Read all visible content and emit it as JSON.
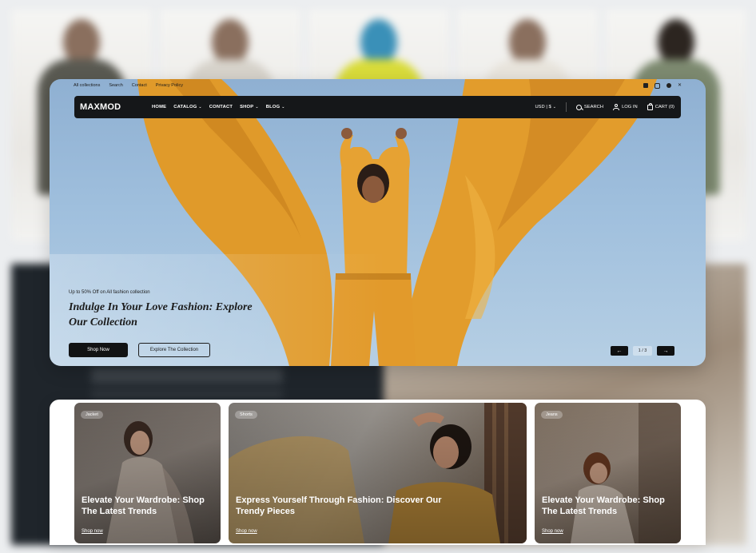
{
  "topbar": {
    "links": [
      "All collections",
      "Search",
      "Contact",
      "Privacy Policy"
    ],
    "socials": [
      "facebook-icon",
      "instagram-icon",
      "pinterest-icon",
      "x-icon"
    ]
  },
  "nav": {
    "logo": "MAXMOD",
    "items": [
      {
        "label": "HOME",
        "dropdown": false
      },
      {
        "label": "CATALOG",
        "dropdown": true
      },
      {
        "label": "CONTACT",
        "dropdown": false
      },
      {
        "label": "SHOP",
        "dropdown": true
      },
      {
        "label": "BLOG",
        "dropdown": true
      }
    ],
    "currency": "USD | $",
    "search": "SEARCH",
    "login": "LOG IN",
    "cart": "CART (0)"
  },
  "hero": {
    "promo": "Up to 50% Off on All fashion collection",
    "headline": "Indulge In Your Love Fashion: Explore Our Collection",
    "primary_button": "Shop Now",
    "secondary_button": "Explore The Collection",
    "prev": "←",
    "next": "→",
    "page": "1 / 3"
  },
  "categories": [
    {
      "tag": "Jacket",
      "title": "Elevate Your Wardrobe: Shop The Latest Trends",
      "link": "Shop now"
    },
    {
      "tag": "Shorts",
      "title": "Express Yourself Through Fashion: Discover Our Trendy Pieces",
      "link": "Shop now"
    },
    {
      "tag": "Jeans",
      "title": "Elevate Your Wardrobe: Shop The Latest Trends",
      "link": "Shop now"
    }
  ],
  "colors": {
    "accent_orange": "#e4a02e",
    "sky": "#9fbfdd",
    "nav_bg": "#151719"
  }
}
